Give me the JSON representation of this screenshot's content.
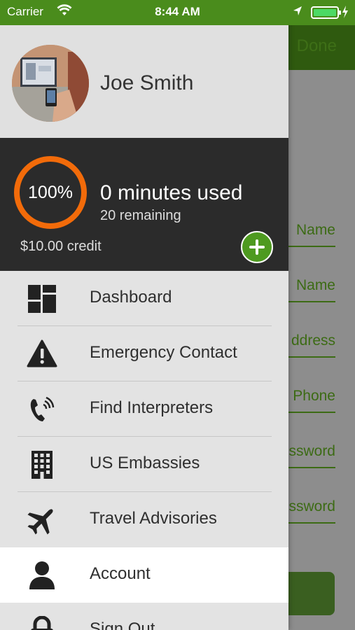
{
  "status_bar": {
    "carrier": "Carrier",
    "time": "8:44 AM"
  },
  "background": {
    "done_label": "Done",
    "fields": [
      "Name",
      "Name",
      "ddress",
      "Phone",
      "ssword",
      "ssword"
    ]
  },
  "profile": {
    "name": "Joe Smith"
  },
  "usage": {
    "percent_label": "100%",
    "percent_value": 100,
    "minutes_used": "0 minutes used",
    "remaining": "20 remaining",
    "credit": "$10.00 credit"
  },
  "menu": {
    "items": [
      {
        "label": "Dashboard",
        "icon": "dashboard-icon"
      },
      {
        "label": "Emergency Contact",
        "icon": "warning-icon"
      },
      {
        "label": "Find Interpreters",
        "icon": "phone-ringing-icon"
      },
      {
        "label": "US Embassies",
        "icon": "building-icon"
      },
      {
        "label": "Travel Advisories",
        "icon": "airplane-icon"
      },
      {
        "label": "Account",
        "icon": "user-icon",
        "active": true
      },
      {
        "label": "Sign Out",
        "icon": "lock-icon"
      }
    ]
  },
  "colors": {
    "brand_green": "#4a8c1c",
    "ring_orange": "#f26b0a",
    "usage_bg": "#2b2b2b"
  }
}
